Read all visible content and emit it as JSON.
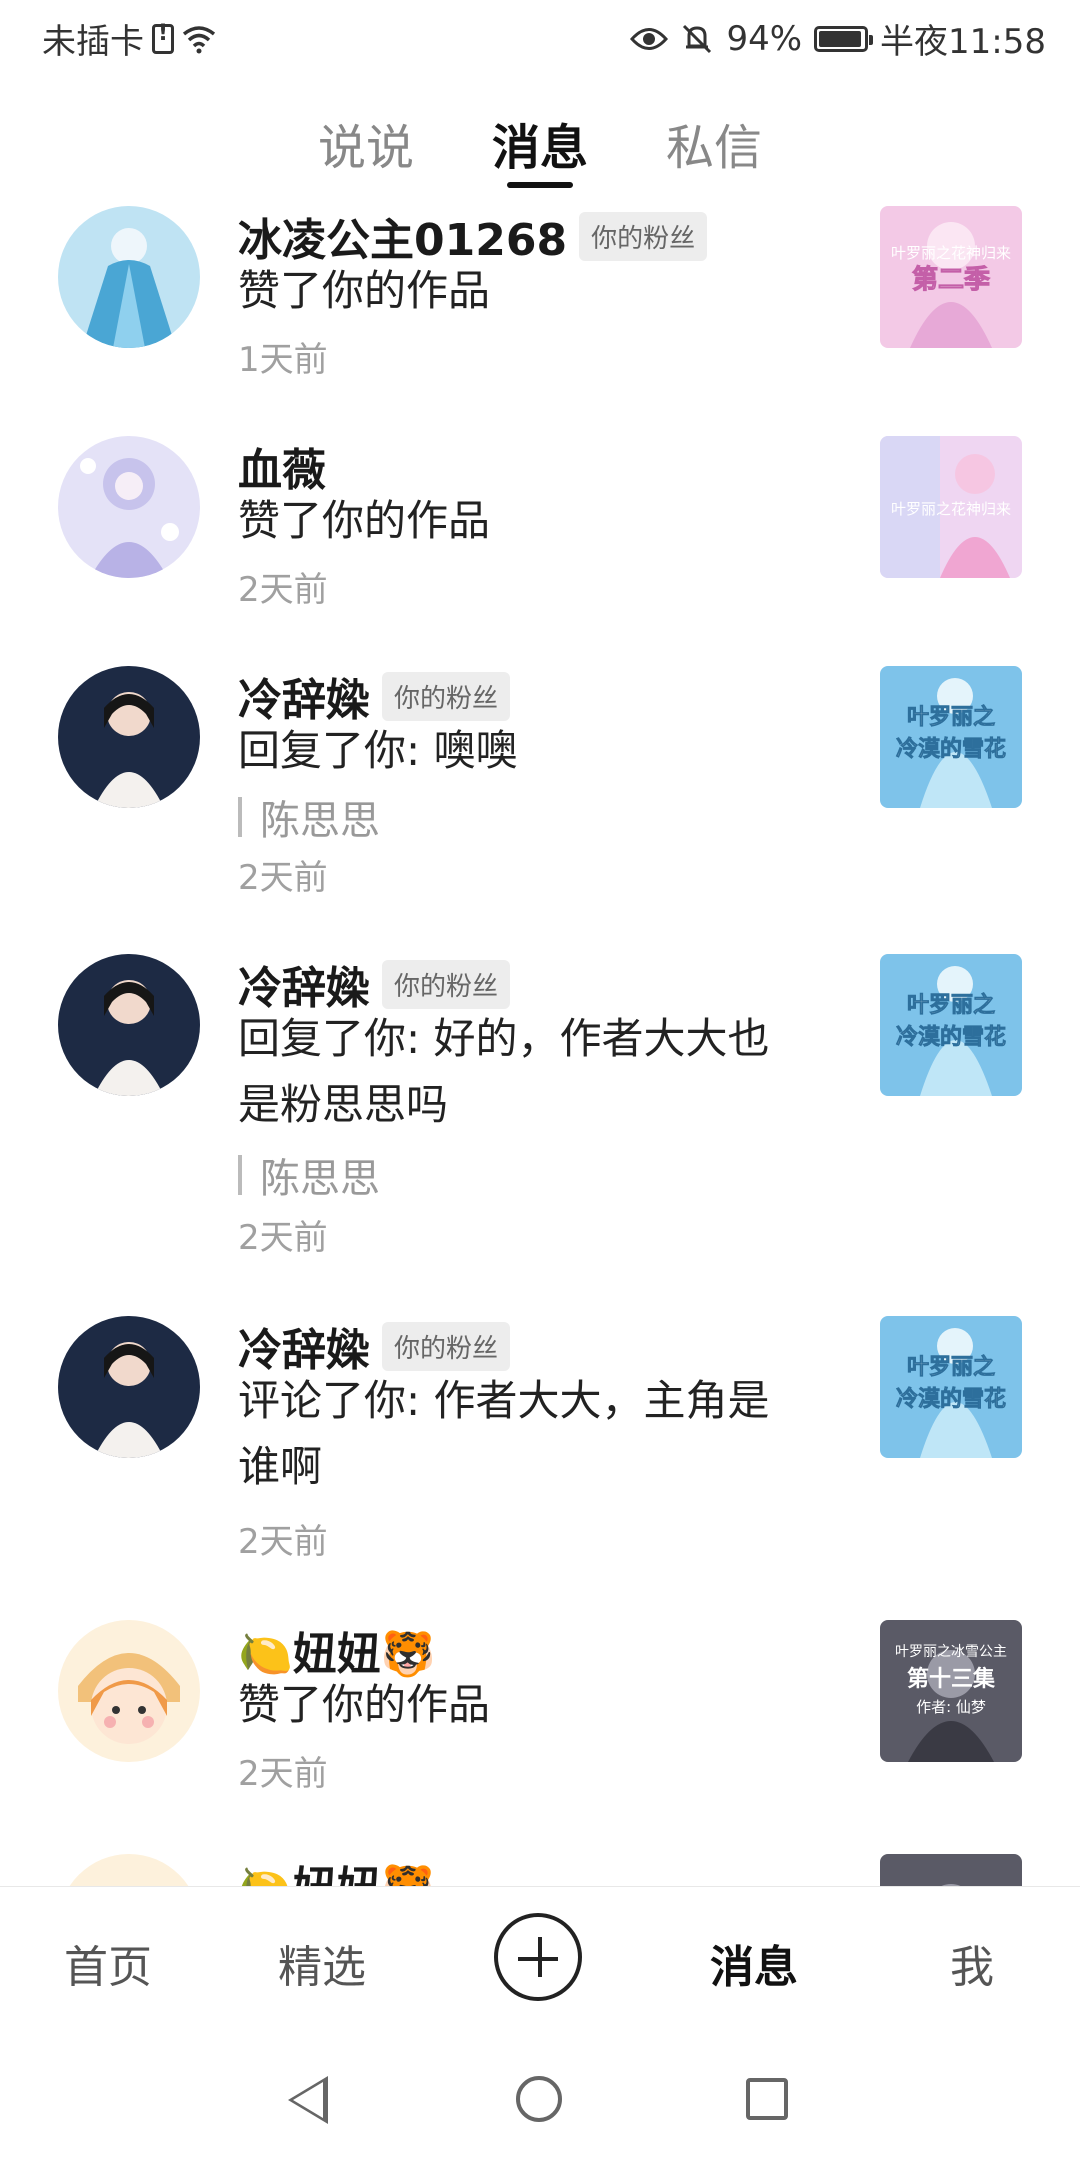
{
  "status_bar": {
    "carrier": "未插卡",
    "battery": "94%",
    "time": "半夜11:58",
    "icons": [
      "sim-alert-icon",
      "wifi-icon",
      "eye-icon",
      "mute-icon",
      "battery-icon"
    ]
  },
  "top_tabs": [
    {
      "label": "说说",
      "active": false
    },
    {
      "label": "消息",
      "active": true
    },
    {
      "label": "私信",
      "active": false
    }
  ],
  "messages": [
    {
      "name": "冰凌公主01268",
      "badge": "你的粉丝",
      "action": "赞了你的作品",
      "time": "1天前",
      "thumb_text": "叶罗丽之花神归来 第二季"
    },
    {
      "name": "血薇",
      "badge": "",
      "action": "赞了你的作品",
      "time": "2天前",
      "thumb_text": "叶罗丽之花神归来"
    },
    {
      "name": "冷辞媣",
      "badge": "你的粉丝",
      "action": "回复了你: 噢噢",
      "quote": "陈思思",
      "time": "2天前",
      "thumb_text": "叶罗丽之冷漠的雪花"
    },
    {
      "name": "冷辞媣",
      "badge": "你的粉丝",
      "action": "回复了你: 好的，作者大大也是粉思思吗",
      "quote": "陈思思",
      "time": "2天前",
      "thumb_text": "叶罗丽之冷漠的雪花"
    },
    {
      "name": "冷辞媣",
      "badge": "你的粉丝",
      "action": "评论了你: 作者大大，主角是谁啊",
      "time": "2天前",
      "thumb_text": "叶罗丽之冷漠的雪花"
    },
    {
      "name": "🍋妞妞🐯",
      "badge": "",
      "action": "赞了你的作品",
      "time": "2天前",
      "thumb_text": "叶罗丽之冰雪公主 第十三集 作者: 仙梦"
    },
    {
      "name": "🍋妞妞🐯",
      "badge": "",
      "action": "",
      "time": "",
      "thumb_text": ""
    }
  ],
  "bottom_nav": [
    {
      "label": "首页",
      "active": false
    },
    {
      "label": "精选",
      "active": false
    },
    {
      "label": "+",
      "active": false
    },
    {
      "label": "消息",
      "active": true
    },
    {
      "label": "我",
      "active": false
    }
  ]
}
